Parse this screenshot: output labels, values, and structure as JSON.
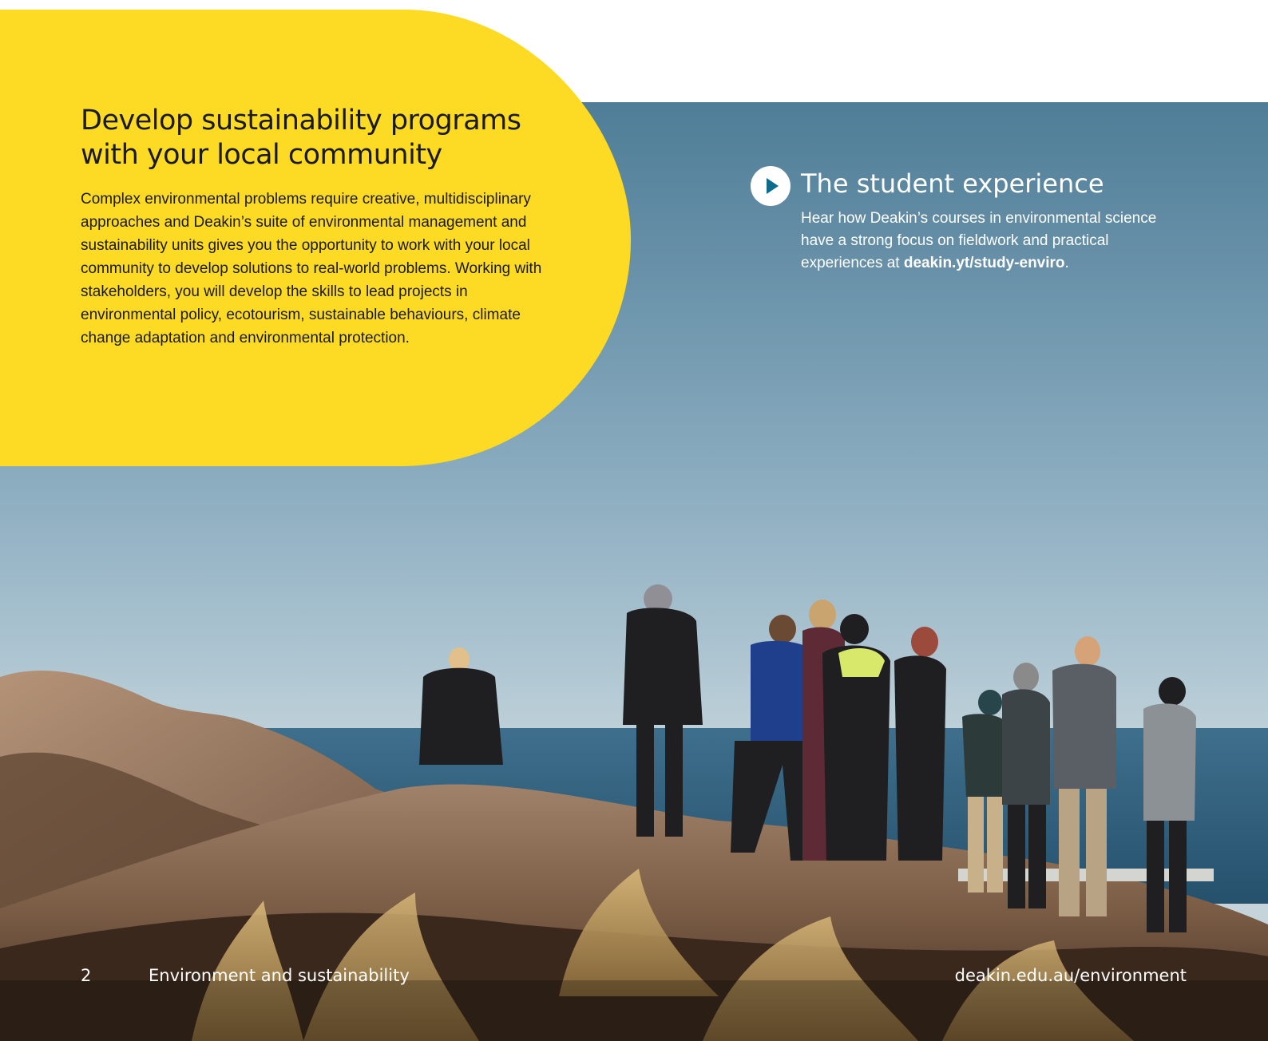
{
  "feature": {
    "heading_line1": "Develop sustainability programs",
    "heading_line2": "with your local community",
    "body": "Complex environmental problems require creative, multidisciplinary approaches and Deakin’s suite of environmental management and sustainability units gives you the opportunity to work with your local community to develop solutions to real-world problems. Working with stakeholders, you will develop the skills to lead projects in environmental policy, ecotourism, sustainable behaviours, climate change adaptation and environmental protection."
  },
  "video_callout": {
    "icon": "play-icon",
    "title": "The student experience",
    "text_before_link": "Hear how Deakin’s courses in environmental science have a strong focus on fieldwork and practical experiences at ",
    "link": "deakin.yt/study-enviro",
    "text_after_link": "."
  },
  "footer": {
    "page_number": "2",
    "section_title": "Environment and sustainability",
    "url": "deakin.edu.au/environment"
  },
  "colors": {
    "accent_yellow": "#fdda24",
    "play_icon_blue": "#0d6b8c",
    "text_dark": "#1a1a1a",
    "text_light": "#ffffff"
  }
}
